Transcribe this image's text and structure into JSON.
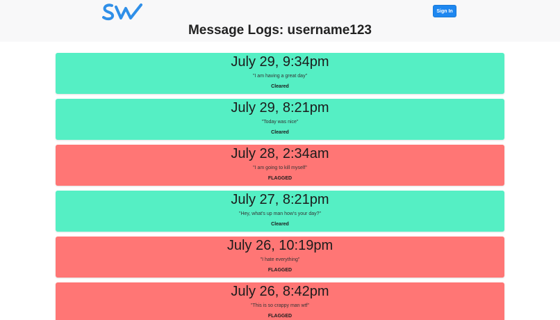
{
  "header": {
    "logo_text": "SW",
    "signin_label": "Sign In",
    "page_title": "Message Logs: username123"
  },
  "colors": {
    "cleared": "#55efc4",
    "flagged": "#ff7675",
    "accent": "#1e87f0"
  },
  "logs": [
    {
      "time": "July 29, 9:34pm",
      "message": "\"I am having a great day\"",
      "status": "Cleared",
      "state": "cleared"
    },
    {
      "time": "July 29, 8:21pm",
      "message": "\"Today was nice\"",
      "status": "Cleared",
      "state": "cleared"
    },
    {
      "time": "July 28, 2:34am",
      "message": "\"I am going to kill myself\"",
      "status": "FLAGGED",
      "state": "flagged"
    },
    {
      "time": "July 27, 8:21pm",
      "message": "\"Hey, what's up man how's your day?\"",
      "status": "Cleared",
      "state": "cleared"
    },
    {
      "time": "July 26, 10:19pm",
      "message": "\"I hate everything\"",
      "status": "FLAGGED",
      "state": "flagged"
    },
    {
      "time": "July 26, 8:42pm",
      "message": "\"This is so crappy man wtf\"",
      "status": "FLAGGED",
      "state": "flagged"
    }
  ]
}
